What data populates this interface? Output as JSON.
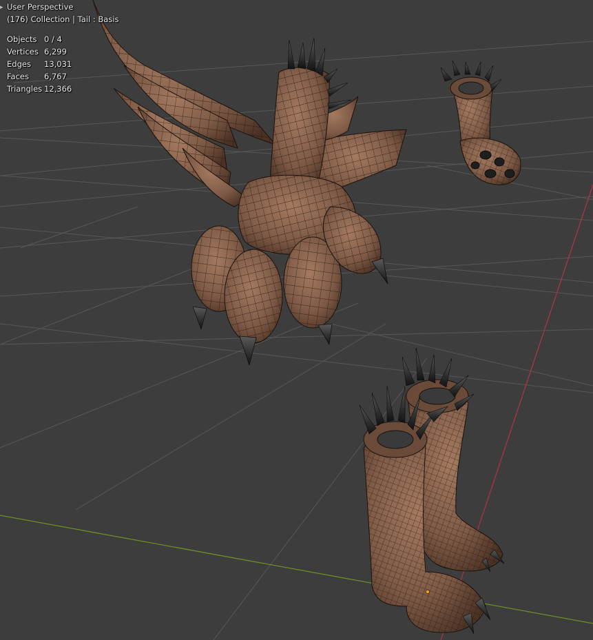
{
  "viewport": {
    "view_name": "User Perspective",
    "context": "(176) Collection | Tail : Basis",
    "stats": [
      {
        "label": "Objects",
        "value": "0 / 4"
      },
      {
        "label": "Vertices",
        "value": "6,299"
      },
      {
        "label": "Edges",
        "value": "13,031"
      },
      {
        "label": "Faces",
        "value": "6,767"
      },
      {
        "label": "Triangles",
        "value": "12,366"
      }
    ],
    "colors": {
      "background": "#3d3d3d",
      "grid": "#575757",
      "x_axis": "#a8344a",
      "y_axis": "#6b8f24",
      "mesh_fill": "#7e5a46",
      "mesh_light": "#a47a60",
      "mesh_dark": "#4a3124",
      "wire": "#1c120c",
      "claw": "#202020",
      "origin": "#ff9a1a"
    },
    "icons": {
      "collapse": "chevron-right-icon"
    }
  }
}
